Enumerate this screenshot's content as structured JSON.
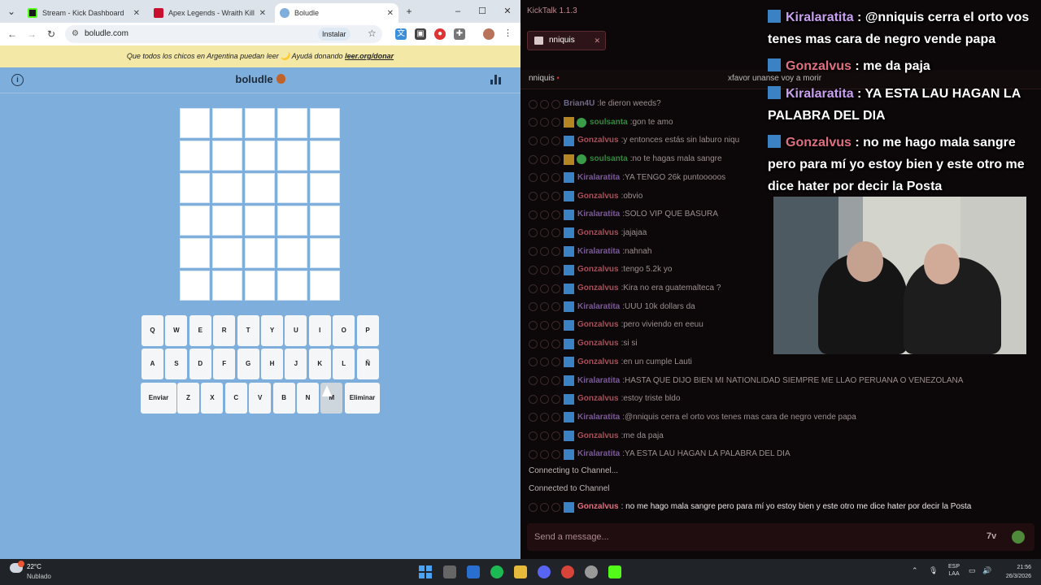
{
  "browser": {
    "tabs": [
      {
        "title": "Stream - Kick Dashboard",
        "color": "#53fc18"
      },
      {
        "title": "Apex Legends - Wraith Kills Le",
        "color": "#c8102e"
      },
      {
        "title": "Boludle",
        "color": "#7eaedb"
      }
    ],
    "url": "boludle.com",
    "install_label": "Instalar",
    "banner_text": "Que todos los chicos en Argentina puedan leer 🌙 Ayudá donando",
    "banner_link": "leer.org/donar",
    "site_title": "boludle",
    "icons": [
      "info-icon",
      "mate-icon",
      "stats-icon"
    ]
  },
  "keyboard": {
    "row1": [
      "Q",
      "W",
      "E",
      "R",
      "T",
      "Y",
      "U",
      "I",
      "O",
      "P"
    ],
    "row2": [
      "A",
      "S",
      "D",
      "F",
      "G",
      "H",
      "J",
      "K",
      "L",
      "Ñ"
    ],
    "enter_label": "Enviar",
    "row3": [
      "Z",
      "X",
      "C",
      "V",
      "B",
      "N",
      "M"
    ],
    "delete_label": "Eliminar"
  },
  "kicktalk": {
    "title": "KickTalk 1.1.3",
    "channel_tab": "nniquis",
    "channel_name": "nniquis",
    "live_dot": "•",
    "pinned_text": "xfavor unanse voy a morir",
    "messages": [
      {
        "user": "Brian4U",
        "text": "le dieron weeds?",
        "color": "#6e6a8a",
        "badge": "none"
      },
      {
        "user": "soulsanta",
        "text": "gon te amo",
        "color": "#2f8a3a",
        "badge": "crown"
      },
      {
        "user": "Gonzalvus",
        "text": "y entonces estás sin laburo niqu",
        "color": "#a8505a",
        "badge": "kick"
      },
      {
        "user": "soulsanta",
        "text": "no te hagas mala sangre",
        "color": "#2f8a3a",
        "badge": "crown"
      },
      {
        "user": "Kiralaratita",
        "text": "YA TENGO 26k puntooooos",
        "color": "#7a5a9a",
        "badge": "kick"
      },
      {
        "user": "Gonzalvus",
        "text": "obvio",
        "color": "#a8505a",
        "badge": "kick"
      },
      {
        "user": "Kiralaratita",
        "text": "SOLO VIP QUE BASURA",
        "color": "#7a5a9a",
        "badge": "kick"
      },
      {
        "user": "Gonzalvus",
        "text": "jajajaa",
        "color": "#a8505a",
        "badge": "kick"
      },
      {
        "user": "Kiralaratita",
        "text": "nahnah",
        "color": "#7a5a9a",
        "badge": "kick"
      },
      {
        "user": "Gonzalvus",
        "text": "tengo 5.2k yo",
        "color": "#a8505a",
        "badge": "kick"
      },
      {
        "user": "Gonzalvus",
        "text": "Kira no era guatemalteca ?",
        "color": "#a8505a",
        "badge": "kick"
      },
      {
        "user": "Kiralaratita",
        "text": "UUU 10k dollars da",
        "color": "#7a5a9a",
        "badge": "kick"
      },
      {
        "user": "Gonzalvus",
        "text": "pero viviendo en eeuu",
        "color": "#a8505a",
        "badge": "kick"
      },
      {
        "user": "Gonzalvus",
        "text": "si si",
        "color": "#a8505a",
        "badge": "kick"
      },
      {
        "user": "Gonzalvus",
        "text": "en un cumple Lauti",
        "color": "#a8505a",
        "badge": "kick"
      },
      {
        "user": "Kiralaratita",
        "text": "HASTA QUE DIJO BIEN MI NATIONLIDAD SIEMPRE ME LLAO PERUANA O VENEZOLANA",
        "color": "#7a5a9a",
        "badge": "kick"
      },
      {
        "user": "Gonzalvus",
        "text": "estoy triste bldo",
        "color": "#a8505a",
        "badge": "kick"
      },
      {
        "user": "Kiralaratita",
        "text": "@nniquis cerra el orto vos tenes mas cara de negro vende papa",
        "color": "#7a5a9a",
        "badge": "kick"
      },
      {
        "user": "Gonzalvus",
        "text": "me da paja",
        "color": "#a8505a",
        "badge": "kick"
      },
      {
        "user": "Kiralaratita",
        "text": "YA ESTA LAU HAGAN LA PALABRA DEL DIA",
        "color": "#7a5a9a",
        "badge": "kick"
      }
    ],
    "system_1": "Connecting to Channel...",
    "system_2": "Connected to Channel",
    "last_message": {
      "user": "Gonzalvus",
      "text": "no me hago mala sangre pero para mí yo estoy bien y este otro me dice hater por decir la Posta",
      "color": "#e07080"
    },
    "input_placeholder": "Send a message...",
    "input_icons": [
      "emote-icon",
      "face-icon"
    ]
  },
  "overlay": {
    "lines": [
      {
        "user": "Kiralaratita",
        "sep": " : ",
        "text": "@nniquis cerra el orto vos tenes mas cara de negro vende papa",
        "color": "#c9a0f0"
      },
      {
        "user": "Gonzalvus",
        "sep": " : ",
        "text": "me da paja",
        "color": "#e07080"
      },
      {
        "user": "Kiralaratita",
        "sep": " : ",
        "text": "YA ESTA LAU HAGAN LA PALABRA DEL DIA",
        "color": "#c9a0f0"
      },
      {
        "user": "Gonzalvus",
        "sep": " : ",
        "text": "no me hago mala sangre pero para mí yo estoy bien y este otro me dice hater por decir la Posta",
        "color": "#e07080"
      }
    ]
  },
  "taskbar": {
    "temperature": "22°C",
    "condition": "Nublado",
    "lang_1": "ESP",
    "lang_2": "LAA",
    "time": "21:56",
    "date": "26/3/2026",
    "weather_badge": "1"
  }
}
